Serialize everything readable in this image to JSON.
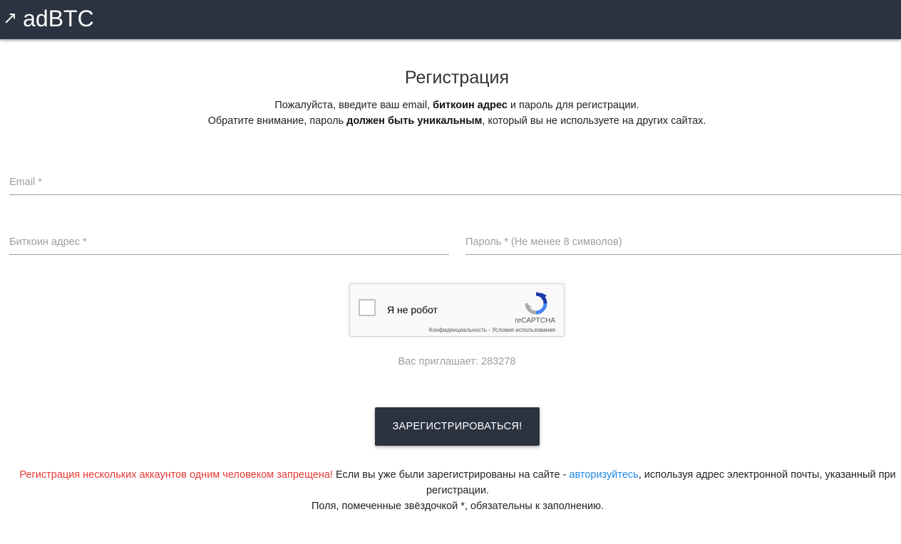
{
  "header": {
    "brand_icon": "↗",
    "brand": "adBTC",
    "bg_color": "#2b3240"
  },
  "form": {
    "title": "Регистрация",
    "intro": {
      "line1_a": "Пожалуйста, введите ваш email, ",
      "line1_bold": "биткоин адрес",
      "line1_b": " и пароль для регистрации.",
      "line2_a": "Обратите внимание, пароль ",
      "line2_bold": "должен быть уникальным",
      "line2_b": ", который вы не используете на других сайтах."
    },
    "email": {
      "placeholder": "Email *",
      "value": ""
    },
    "bitcoin_address": {
      "placeholder": "Биткоин адрес *",
      "value": ""
    },
    "password": {
      "placeholder": "Пароль * (Не менее 8 символов)",
      "value": ""
    },
    "captcha": {
      "label": "Я не робот",
      "brand": "reCAPTCHA",
      "links": "Конфиденциальность - Условия использования",
      "checked": false
    },
    "invite_text": "Вас приглашает: 283278",
    "submit_label": "ЗАРЕГИСТРИРОВАТЬСЯ!"
  },
  "footer": {
    "warning": "Регистрация нескольких аккаунтов одним человеком запрещена!",
    "text_a": " Если вы уже были зарегистрированы на сайте - ",
    "login_link": "авторизуйтесь",
    "text_b": ", используя адрес электронной почты, указанный при регистрации.",
    "required_note": "Поля, помеченные звёздочкой *, обязательны к заполнению.",
    "warning_color": "#e53935",
    "link_color": "#1e88e5"
  }
}
